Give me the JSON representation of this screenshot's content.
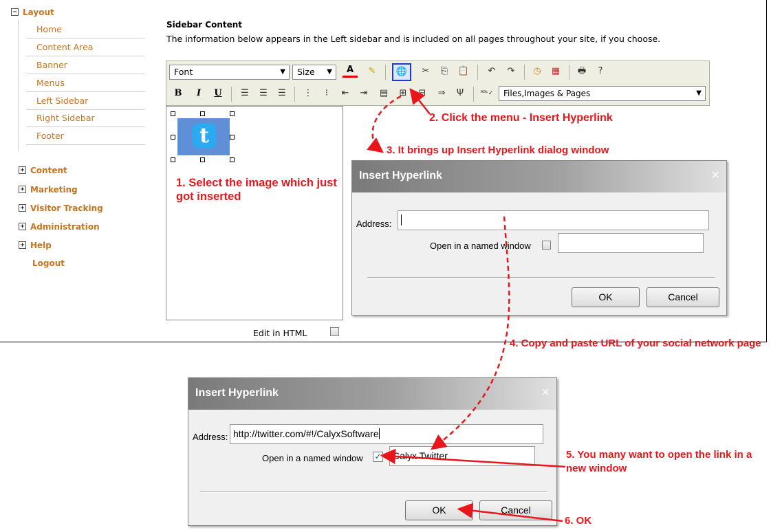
{
  "nav": {
    "layout": "Layout",
    "sub": [
      "Home",
      "Content Area",
      "Banner",
      "Menus",
      "Left Sidebar",
      "Right Sidebar",
      "Footer"
    ],
    "sections": [
      "Content",
      "Marketing",
      "Visitor Tracking",
      "Administration",
      "Help"
    ],
    "logout": "Logout"
  },
  "sidebar_content": {
    "title": "Sidebar Content",
    "description": "The information below appears in the Left sidebar and is included on all pages throughout your site, if you choose."
  },
  "toolbar": {
    "font": "Font",
    "size": "Size",
    "bold": "B",
    "italic": "I",
    "underline": "U",
    "files": "Files,Images & Pages"
  },
  "edit_in_html": "Edit in HTML",
  "dialog1": {
    "title": "Insert Hyperlink",
    "close": "×",
    "address_label": "Address:",
    "address_value": "",
    "named_window_label": "Open in a named window",
    "window_name_value": "",
    "ok": "OK",
    "cancel": "Cancel"
  },
  "dialog2": {
    "title": "Insert Hyperlink",
    "close": "×",
    "address_label": "Address:",
    "address_value": "http://twitter.com/#!/CalyxSoftware",
    "named_window_label": "Open in a named window",
    "window_name_value": "Calyx Twitter",
    "ok": "OK",
    "cancel": "Cancel"
  },
  "annotations": {
    "step1": "1. Select the image which just got inserted",
    "step2": "2. Click the menu - Insert Hyperlink",
    "step3": "3. It brings up Insert Hyperlink dialog window",
    "step4": "4. Copy and paste URL of your social network page",
    "step5": "5. You many want to open the link in a new window",
    "step6": "6. OK"
  },
  "colors": {
    "annotation": "#e8161b",
    "nav_link": "#c8741f",
    "toolbar_bg": "#eeeee2",
    "highlight": "#1a3ccd"
  }
}
